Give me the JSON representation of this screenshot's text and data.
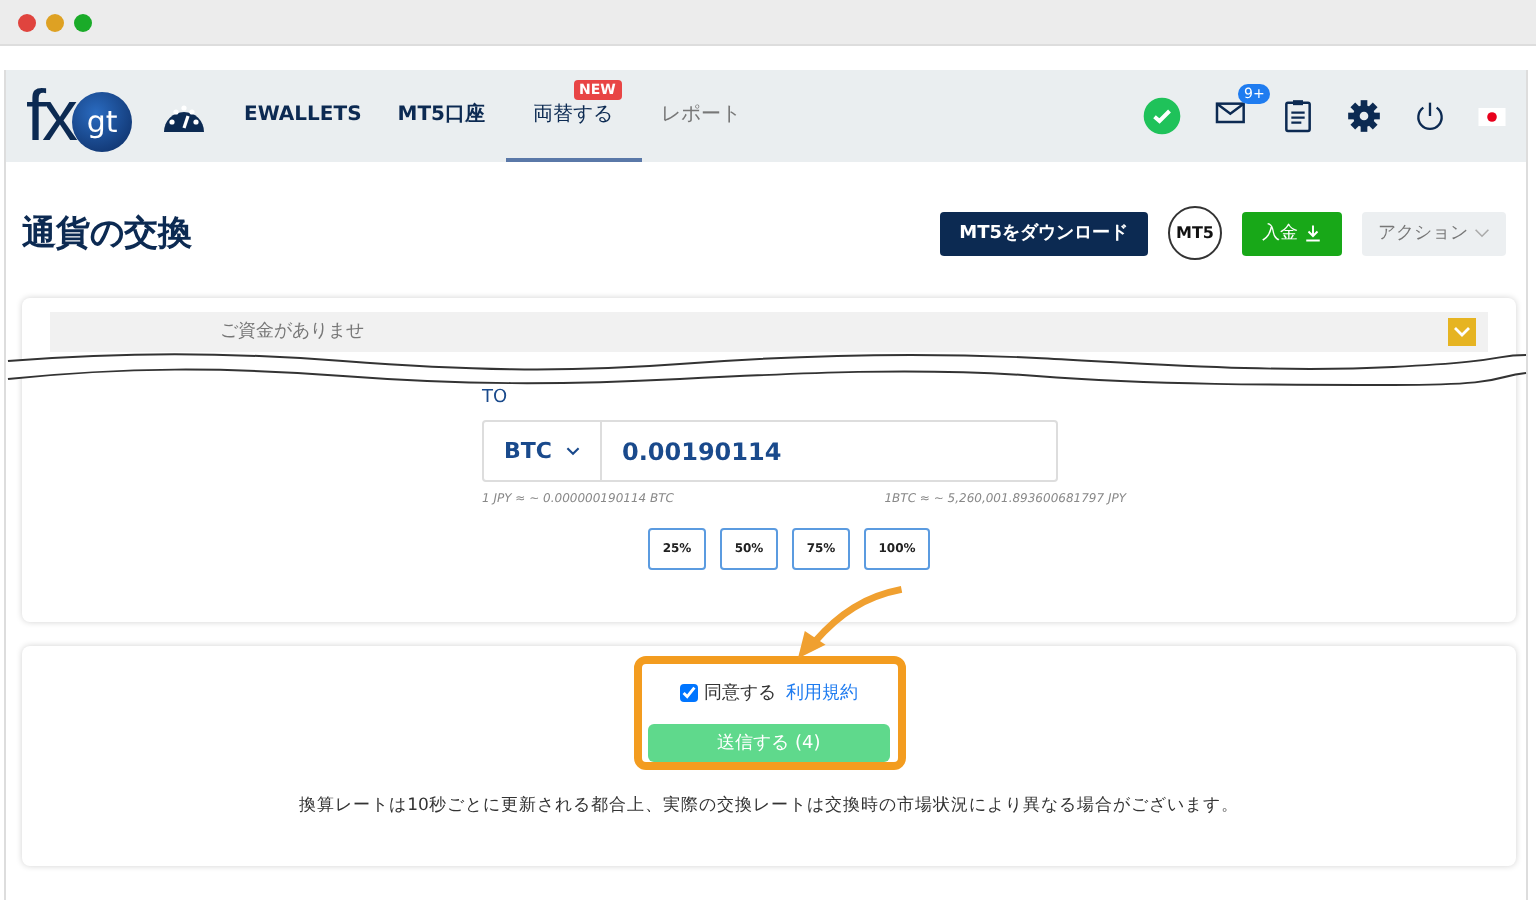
{
  "logo": {
    "left": "fx",
    "right": "gt"
  },
  "nav": [
    {
      "label": "EWALLETS",
      "selected": false
    },
    {
      "label": "MT5口座",
      "selected": false
    },
    {
      "label": "両替する",
      "selected": true,
      "badge": "NEW"
    },
    {
      "label": "レポート",
      "selected": false
    }
  ],
  "mail_badge": "9+",
  "page_title": "通貨の交換",
  "actions": [
    {
      "kind": "dark",
      "label": "MT5をダウンロード"
    },
    {
      "kind": "circle",
      "label": "MT5"
    },
    {
      "kind": "green",
      "label": "入金"
    },
    {
      "kind": "dropdown",
      "label": "アクション"
    }
  ],
  "exchange": {
    "banner_text": "ご資金がありませ",
    "to_label": "TO",
    "currency": "BTC",
    "amount": "0.00190114",
    "rate_left": "1 JPY ≈ ~ 0.000000190114 BTC",
    "rate_right": "1BTC ≈ ~ 5,260,001.893600681797 JPY",
    "percents": [
      "25%",
      "50%",
      "75%",
      "100%"
    ]
  },
  "confirm": {
    "checked": true,
    "label": "同意する",
    "link": "利用規約",
    "submit": "送信する (4)",
    "note": "換算レートは10秒ごとに更新される都合上、実際の交換レートは交換時の市場状況により異なる場合がございます。"
  }
}
